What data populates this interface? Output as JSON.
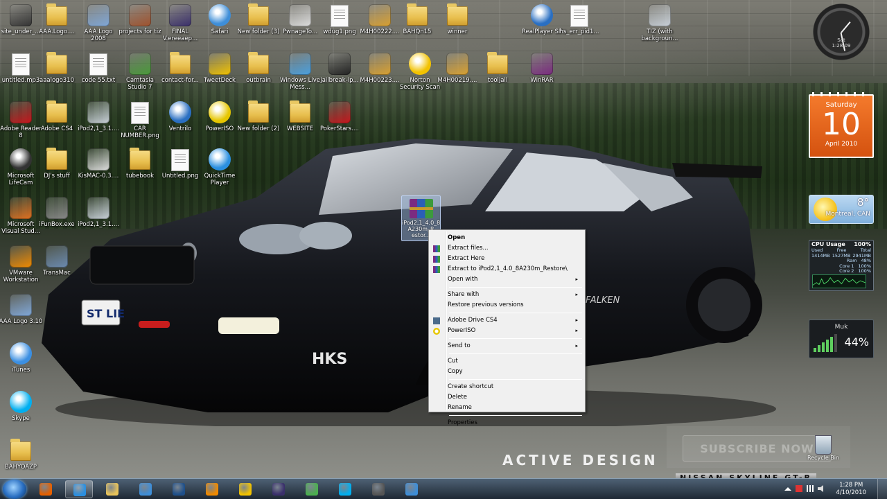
{
  "desktop": {
    "icons": [
      {
        "label": "site_under_...",
        "kind": "app",
        "color": "#333333"
      },
      {
        "label": "AAA.Logo....",
        "kind": "folder"
      },
      {
        "label": "AAA Logo 2008",
        "kind": "app",
        "color": "#7fa7d8"
      },
      {
        "label": "projects for tiz",
        "kind": "app",
        "color": "#a0522d"
      },
      {
        "label": "FINAL V.ereeaep...",
        "kind": "app",
        "color": "#3a2f6b"
      },
      {
        "label": "Safari",
        "kind": "round",
        "color": "#3e8ed8"
      },
      {
        "label": "New folder (3)",
        "kind": "folder"
      },
      {
        "label": "PwnageTo...",
        "kind": "app",
        "color": "#dddddd"
      },
      {
        "label": "wdug1.png",
        "kind": "doc"
      },
      {
        "label": "M4H00222....",
        "kind": "app",
        "color": "#d9a030"
      },
      {
        "label": "BAHQn15",
        "kind": "folder"
      },
      {
        "label": "winner",
        "kind": "folder"
      },
      {
        "label": "RealPlayer SP",
        "kind": "round",
        "color": "#2a6fc2"
      },
      {
        "label": "hs_err_pid1...",
        "kind": "doc"
      },
      {
        "label": "TIZ (with backgroun...",
        "kind": "app",
        "color": "#c8d0d8"
      },
      {
        "label": "untitled.mp3",
        "kind": "doc"
      },
      {
        "label": "aaalogo310",
        "kind": "folder"
      },
      {
        "label": "code 55.txt",
        "kind": "doc"
      },
      {
        "label": "Camtasia Studio 7",
        "kind": "app",
        "color": "#4a9a3a"
      },
      {
        "label": "contact-for...",
        "kind": "folder"
      },
      {
        "label": "TweetDeck",
        "kind": "app",
        "color": "#f2c200"
      },
      {
        "label": "outbrain",
        "kind": "folder"
      },
      {
        "label": "Windows Live Mess...",
        "kind": "app",
        "color": "#4aa0e0"
      },
      {
        "label": "jailbreak-ip...",
        "kind": "app",
        "color": "#222222"
      },
      {
        "label": "M4H00223....",
        "kind": "app",
        "color": "#d9a030"
      },
      {
        "label": "Norton Security Scan",
        "kind": "round",
        "color": "#f2c200"
      },
      {
        "label": "M4H00219....",
        "kind": "app",
        "color": "#d9a030"
      },
      {
        "label": "tooljail",
        "kind": "folder"
      },
      {
        "label": "WinRAR",
        "kind": "app",
        "color": "#7b2b80"
      },
      {
        "label": "Adobe Reader 8",
        "kind": "app",
        "color": "#c8161d"
      },
      {
        "label": "Adobe CS4",
        "kind": "folder"
      },
      {
        "label": "iPod2,1_3.1....",
        "kind": "app",
        "color": "#c8d0d8"
      },
      {
        "label": "CAR NUMBER.png",
        "kind": "doc"
      },
      {
        "label": "Ventrilo",
        "kind": "round",
        "color": "#2a6fc2"
      },
      {
        "label": "PowerISO",
        "kind": "round",
        "color": "#e6c600"
      },
      {
        "label": "New folder (2)",
        "kind": "folder"
      },
      {
        "label": "WEBSITE",
        "kind": "folder"
      },
      {
        "label": "PokerStars....",
        "kind": "app",
        "color": "#c8161d"
      },
      {
        "label": "Microsoft LifeCam",
        "kind": "round",
        "color": "#333333"
      },
      {
        "label": "DJ's stuff",
        "kind": "folder"
      },
      {
        "label": "KisMAC-0.3....",
        "kind": "app",
        "color": "#dddddd"
      },
      {
        "label": "tubebook",
        "kind": "folder"
      },
      {
        "label": "Untitled.png",
        "kind": "doc"
      },
      {
        "label": "QuickTime Player",
        "kind": "round",
        "color": "#2a8fe0"
      },
      {
        "label": "Microsoft Visual Stud...",
        "kind": "app",
        "color": "#e07020"
      },
      {
        "label": "iFunBox.exe",
        "kind": "app",
        "color": "#888888"
      },
      {
        "label": "iPod2,1_3.1....",
        "kind": "app",
        "color": "#c8d0d8"
      },
      {
        "label": "VMware Workstation",
        "kind": "app",
        "color": "#f08a00"
      },
      {
        "label": "TransMac",
        "kind": "app",
        "color": "#6a8ab0"
      },
      {
        "label": "AAA Logo 3.10",
        "kind": "app",
        "color": "#7fa7d8"
      },
      {
        "label": "iTunes",
        "kind": "round",
        "color": "#3b8fe2"
      },
      {
        "label": "Skype",
        "kind": "round",
        "color": "#00aff0"
      },
      {
        "label": "BAHYOAZP",
        "kind": "folder"
      }
    ],
    "selected_file": {
      "label": "iPod2,1_4.0_8 A230m_R estor..."
    },
    "recycle_bin": {
      "label": "Recycle Bin"
    },
    "wallpaper_text": {
      "brand": "ACTIVE DESIGN",
      "car": "NISSAN SKYLINE GT-R"
    },
    "watermark": {
      "label": "SUBSCRIBE NOW"
    }
  },
  "context_menu": {
    "items": [
      {
        "label": "Open",
        "bold": true
      },
      {
        "label": "Extract files...",
        "icon": "winrar-icon"
      },
      {
        "label": "Extract Here",
        "icon": "winrar-icon"
      },
      {
        "label": "Extract to iPod2,1_4.0_8A230m_Restore\\",
        "icon": "winrar-icon"
      },
      {
        "label": "Open with",
        "submenu": true
      },
      {
        "separator": true
      },
      {
        "label": "Share with",
        "submenu": true
      },
      {
        "label": "Restore previous versions"
      },
      {
        "separator": true
      },
      {
        "label": "Adobe Drive CS4",
        "submenu": true,
        "icon": "adobe-drive-icon"
      },
      {
        "label": "PowerISO",
        "submenu": true,
        "icon": "poweriso-icon"
      },
      {
        "separator": true
      },
      {
        "label": "Send to",
        "submenu": true
      },
      {
        "separator": true
      },
      {
        "label": "Cut"
      },
      {
        "label": "Copy"
      },
      {
        "separator": true
      },
      {
        "label": "Create shortcut"
      },
      {
        "label": "Delete"
      },
      {
        "label": "Rename"
      },
      {
        "separator": true
      },
      {
        "label": "Properties"
      }
    ]
  },
  "gadgets": {
    "clock": {
      "day": "Sat",
      "time": "1:28:09"
    },
    "calendar": {
      "weekday": "Saturday",
      "day": "10",
      "month_year": "April 2010"
    },
    "weather": {
      "temp": "8°",
      "city": "Montreal, CAN"
    },
    "cpu": {
      "title": "CPU Usage",
      "percent": "100%",
      "headers": [
        "Used",
        "Free",
        "Total"
      ],
      "values": [
        "1414MB",
        "1527MB",
        "2941MB"
      ],
      "rows": [
        [
          "Ram",
          "48%"
        ],
        [
          "Core 1",
          "100%"
        ],
        [
          "Core 2",
          "100%"
        ]
      ]
    },
    "network": {
      "name": "Muk",
      "signal": "44%"
    }
  },
  "taskbar": {
    "apps": [
      {
        "name": "firefox",
        "color": "#e66000"
      },
      {
        "name": "internet-explorer",
        "color": "#2a8fe0",
        "active": true
      },
      {
        "name": "explorer",
        "color": "#e8c35a"
      },
      {
        "name": "windows-media-player-alt",
        "color": "#3e8ed8"
      },
      {
        "name": "photoshop",
        "color": "#1e4f8a"
      },
      {
        "name": "media-player",
        "color": "#f08a00"
      },
      {
        "name": "tweetdeck",
        "color": "#f2c200"
      },
      {
        "name": "after-effects",
        "color": "#3a2f6b"
      },
      {
        "name": "chrome",
        "color": "#4caf50"
      },
      {
        "name": "skype",
        "color": "#00aff0"
      },
      {
        "name": "camtasia",
        "color": "#555555"
      },
      {
        "name": "safari",
        "color": "#3e8ed8"
      }
    ],
    "time": "1:28 PM",
    "date": "4/10/2010"
  }
}
